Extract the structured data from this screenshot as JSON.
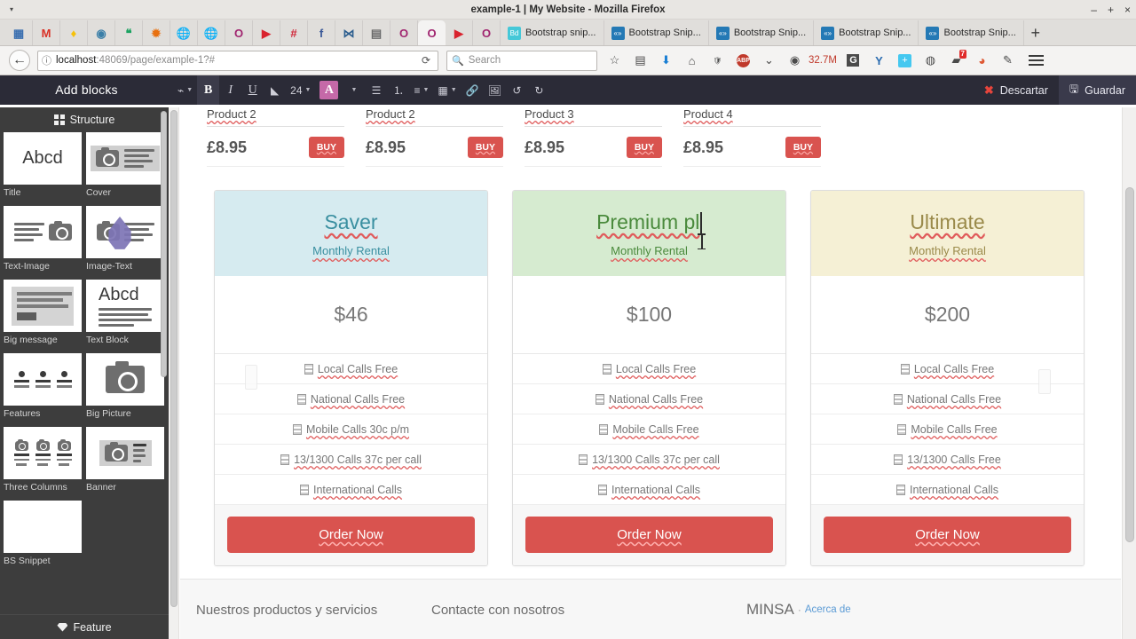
{
  "window": {
    "title": "example-1 | My Website - Mozilla Firefox",
    "minimize": "–",
    "maximize": "+",
    "close": "×",
    "menu_arrow": "▾"
  },
  "tabs": {
    "pinned": [
      {
        "name": "apps-grid-favicon",
        "glyph": "▦",
        "color": "#3a6fb0"
      },
      {
        "name": "gmail-favicon",
        "glyph": "M",
        "color": "#d93025"
      },
      {
        "name": "keep-favicon",
        "glyph": "♦",
        "color": "#f6c10a"
      },
      {
        "name": "feedly-favicon",
        "glyph": "◉",
        "color": "#3b7fa8"
      },
      {
        "name": "hangouts-favicon",
        "glyph": "❝",
        "color": "#1aa260"
      },
      {
        "name": "photos-favicon",
        "glyph": "✹",
        "color": "#e8700f"
      },
      {
        "name": "globe-grey-favicon",
        "glyph": "🌐",
        "color": "#8d8d8d"
      },
      {
        "name": "globe-grey2-favicon",
        "glyph": "🌐",
        "color": "#9aa3a8"
      },
      {
        "name": "opera-purple-favicon",
        "glyph": "O",
        "color": "#a0246f"
      },
      {
        "name": "youtube-speaker-favicon",
        "glyph": "▶",
        "color": "#d9232e"
      },
      {
        "name": "hash-favicon",
        "glyph": "#",
        "color": "#d0283a"
      },
      {
        "name": "facebook-favicon",
        "glyph": "f",
        "color": "#3b5998"
      },
      {
        "name": "dna-favicon",
        "glyph": "⋈",
        "color": "#2b5d8e"
      },
      {
        "name": "building-favicon",
        "glyph": "▤",
        "color": "#6b6b6b"
      },
      {
        "name": "opera-purple2-favicon",
        "glyph": "O",
        "color": "#a0246f"
      },
      {
        "name": "opera-active-favicon",
        "glyph": "O",
        "color": "#a0246f"
      },
      {
        "name": "youtube-favicon",
        "glyph": "▶",
        "color": "#d9232e"
      },
      {
        "name": "opera-purple3-favicon",
        "glyph": "O",
        "color": "#a0246f"
      }
    ],
    "items": [
      {
        "label": "Bootstrap snip...",
        "favicon_text": "Bd",
        "favicon_color": "#45c8d8"
      },
      {
        "label": "Bootstrap Snip...",
        "favicon_text": "«»",
        "favicon_color": "#2479b5"
      },
      {
        "label": "Bootstrap Snip...",
        "favicon_text": "«»",
        "favicon_color": "#2479b5"
      },
      {
        "label": "Bootstrap Snip...",
        "favicon_text": "«»",
        "favicon_color": "#2479b5"
      },
      {
        "label": "Bootstrap Snip...",
        "favicon_text": "«»",
        "favicon_color": "#2479b5"
      }
    ],
    "new_tab_label": "+"
  },
  "navbar": {
    "back_glyph": "←",
    "identity_icon": "ⓘ",
    "url_host": "localhost",
    "url_path": ":48069/page/example-1?#",
    "reload_glyph": "⟳",
    "search_icon": "🔍",
    "search_placeholder": "Search",
    "memory_label": "32.7M",
    "icons": [
      {
        "name": "bookmark-star-icon",
        "glyph": "☆"
      },
      {
        "name": "library-icon",
        "glyph": "▤"
      },
      {
        "name": "downloads-icon",
        "glyph": "⬇"
      },
      {
        "name": "home-icon",
        "glyph": "⌂"
      },
      {
        "name": "shield-icon",
        "glyph": "🛡"
      },
      {
        "name": "adblock-plus-icon",
        "glyph": "ABP"
      },
      {
        "name": "chevron-down-icon",
        "glyph": "⌄"
      },
      {
        "name": "memory-meter-icon",
        "glyph": "◉"
      },
      {
        "name": "grammarly-icon",
        "glyph": "G"
      },
      {
        "name": "yandex-icon",
        "glyph": "Y"
      },
      {
        "name": "add-plus-icon",
        "glyph": "+"
      },
      {
        "name": "pocket-icon",
        "glyph": "◍"
      },
      {
        "name": "notes-icon",
        "glyph": "▰",
        "badge": "7"
      },
      {
        "name": "duckduckgo-icon",
        "glyph": "◕"
      },
      {
        "name": "eyedropper-icon",
        "glyph": "✎"
      }
    ],
    "menu_label": "menu"
  },
  "editor_toolbar": {
    "title": "Add blocks",
    "tools": [
      {
        "name": "format-painter-button",
        "label": "⌁",
        "caret": true,
        "active": false
      },
      {
        "name": "bold-button",
        "label": "B",
        "style": "bold",
        "active": true
      },
      {
        "name": "italic-button",
        "label": "I",
        "style": "italic",
        "active": false
      },
      {
        "name": "underline-button",
        "label": "U",
        "style": "underline",
        "active": false
      },
      {
        "name": "clear-format-button",
        "label": "◣",
        "active": false
      },
      {
        "name": "font-size-select",
        "label": "24",
        "caret": true,
        "active": false
      },
      {
        "name": "text-color-button",
        "label": "A",
        "style": "color",
        "active": false
      },
      {
        "name": "text-color-caret",
        "label": "",
        "caret": true,
        "active": false
      },
      {
        "name": "bullet-list-button",
        "label": "☰",
        "active": false
      },
      {
        "name": "numbered-list-button",
        "label": "⒈",
        "active": false
      },
      {
        "name": "align-button",
        "label": "≡",
        "caret": true,
        "active": false
      },
      {
        "name": "table-button",
        "label": "▦",
        "caret": true,
        "active": false
      },
      {
        "name": "link-button",
        "label": "🔗",
        "active": false
      },
      {
        "name": "image-button",
        "label": "🖼",
        "active": false
      },
      {
        "name": "undo-button",
        "label": "↺",
        "active": false
      },
      {
        "name": "redo-button",
        "label": "↻",
        "active": false
      }
    ],
    "discard_label": "Descartar",
    "discard_icon": "✖",
    "save_label": "Guardar",
    "save_icon": "💾"
  },
  "blocks_panel": {
    "section_title": "Structure",
    "items": [
      {
        "label": "Title",
        "thumb": "abcd"
      },
      {
        "label": "Cover",
        "thumb": "cover"
      },
      {
        "label": "Text-Image",
        "thumb": "text-image"
      },
      {
        "label": "Image-Text",
        "thumb": "image-text"
      },
      {
        "label": "Big message",
        "thumb": "big-message"
      },
      {
        "label": "Text Block",
        "thumb": "text-block"
      },
      {
        "label": "Features",
        "thumb": "features"
      },
      {
        "label": "Big Picture",
        "thumb": "big-picture"
      },
      {
        "label": "Three Columns",
        "thumb": "three-columns"
      },
      {
        "label": "Banner",
        "thumb": "banner"
      },
      {
        "label": "BS Snippet",
        "thumb": "code"
      }
    ],
    "abcd_text": "Abcd",
    "code_text": "</>",
    "footer_label": "Feature"
  },
  "page": {
    "products": [
      {
        "name": "Product 2",
        "price": "£8.95",
        "buy_label": "BUY"
      },
      {
        "name": "Product 2",
        "price": "£8.95",
        "buy_label": "BUY"
      },
      {
        "name": "Product 3",
        "price": "£8.95",
        "buy_label": "BUY"
      },
      {
        "name": "Product 4",
        "price": "£8.95",
        "buy_label": "BUY"
      }
    ],
    "pricing_plans": [
      {
        "title": "Saver",
        "subtitle": "Monthly Rental",
        "price": "$46",
        "header_bg": "#d6ebf0",
        "title_color": "#3a8fa0",
        "sub_color": "#3a8fa0",
        "editing": false,
        "features": [
          "Local Calls Free",
          "National Calls Free",
          "Mobile Calls 30c p/m",
          "13/1300 Calls 37c per call",
          "International Calls"
        ],
        "cta": "Order Now"
      },
      {
        "title": "Premium pl",
        "subtitle": "Monthly Rental",
        "price": "$100",
        "header_bg": "#d6ebd0",
        "title_color": "#4a8a3c",
        "sub_color": "#4a8a3c",
        "editing": true,
        "features": [
          "Local Calls Free",
          "National Calls Free",
          "Mobile Calls Free",
          "13/1300 Calls 37c per call",
          "International Calls"
        ],
        "cta": "Order Now"
      },
      {
        "title": "Ultimate",
        "subtitle": "Monthly Rental",
        "price": "$200",
        "header_bg": "#f5f0d5",
        "title_color": "#9a8a4a",
        "sub_color": "#9a8a4a",
        "editing": false,
        "features": [
          "Local Calls Free",
          "National Calls Free",
          "Mobile Calls Free",
          "13/1300 Calls Free",
          "International Calls"
        ],
        "cta": "Order Now"
      }
    ],
    "footer": {
      "col1": "Nuestros productos y servicios",
      "col2": "Contacte con nosotros",
      "brand": "MINSA",
      "separator": "·",
      "link": "Acerca de"
    }
  },
  "colors": {
    "accent_red": "#d9534f",
    "toolbar_dark": "#2b2b37",
    "panel_dark": "#3d3d3d",
    "drop_marker": "#7d74b5",
    "text_color_btn": "#c569a8"
  }
}
